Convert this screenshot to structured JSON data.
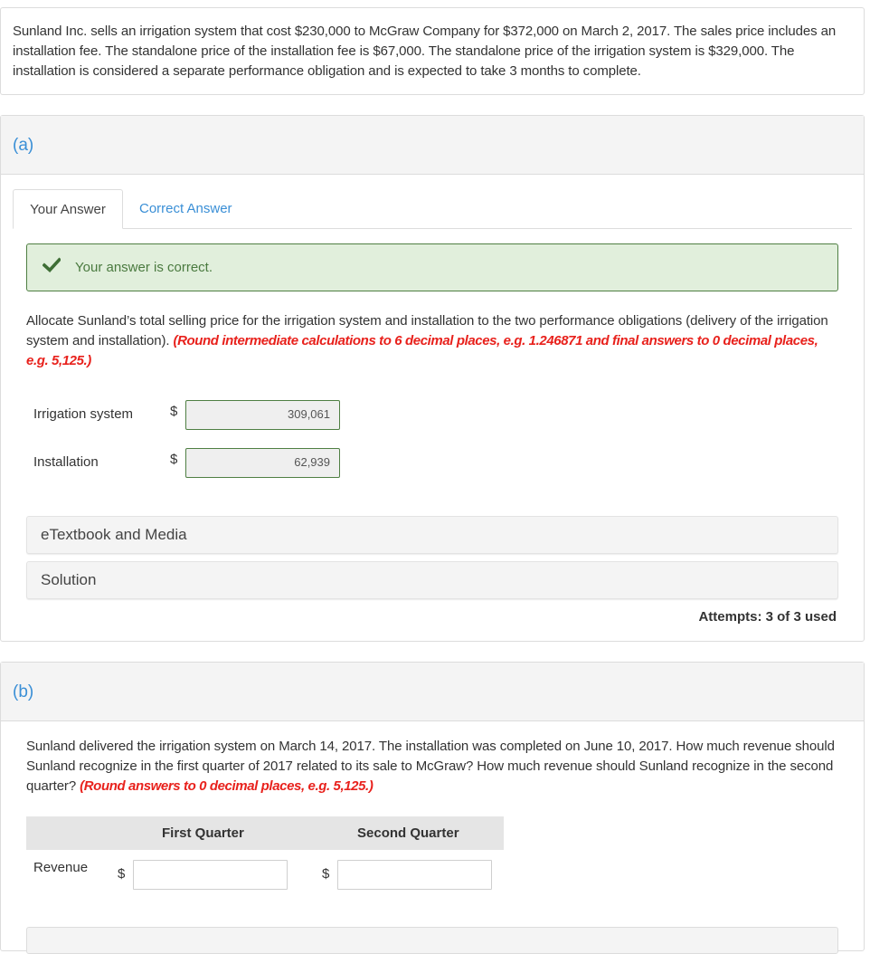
{
  "intro": {
    "text": "Sunland Inc. sells an irrigation system that cost $230,000 to McGraw Company for $372,000 on March 2, 2017. The sales price includes an installation fee. The standalone price of the installation fee is $67,000. The standalone price of the irrigation system is $329,000. The installation is considered a separate performance obligation and is expected to take 3 months to complete."
  },
  "part_a": {
    "label": "(a)",
    "tabs": [
      {
        "label": "Your Answer",
        "active": true
      },
      {
        "label": "Correct Answer",
        "active": false
      }
    ],
    "alert": {
      "icon": "checkmark-icon",
      "message": "Your answer is correct.",
      "color": "#4a7a3f"
    },
    "question": "Allocate Sunland’s total selling price for the irrigation system and installation to the two performance obligations (delivery of the irrigation system and installation).",
    "hint": "(Round intermediate calculations to 6 decimal places, e.g. 1.246871 and final answers to 0 decimal places, e.g. 5,125.)",
    "fields": [
      {
        "label": "Irrigation system",
        "currency": "$",
        "value": "309,061"
      },
      {
        "label": "Installation",
        "currency": "$",
        "value": "62,939"
      }
    ],
    "accordions": [
      {
        "label": "eTextbook and Media"
      },
      {
        "label": "Solution"
      }
    ],
    "attempts": "Attempts: 3 of 3 used"
  },
  "part_b": {
    "label": "(b)",
    "question": "Sunland delivered the irrigation system on March 14, 2017. The installation was completed on June 10, 2017. How much revenue should Sunland recognize in the first quarter of 2017 related to its sale to McGraw? How much revenue should Sunland recognize in the second quarter?",
    "hint": "(Round answers to 0 decimal places, e.g. 5,125.)",
    "table": {
      "columns": [
        "First Quarter",
        "Second Quarter"
      ],
      "row_label": "Revenue",
      "currency": "$",
      "values": [
        "",
        ""
      ]
    }
  },
  "colors": {
    "link_blue": "#3a8fd6",
    "hint_red": "#e8211c",
    "success_bg": "#e1efdc",
    "success_border": "#4f7f43"
  }
}
